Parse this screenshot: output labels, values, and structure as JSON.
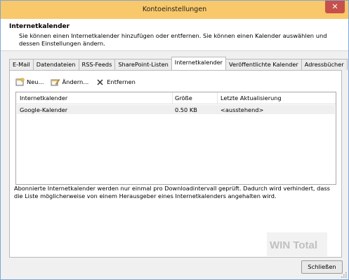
{
  "window": {
    "title": "Kontoeinstellungen",
    "close_glyph": "✕"
  },
  "header": {
    "title": "Internetkalender",
    "description": "Sie können einen Internetkalender hinzufügen oder entfernen. Sie können einen Kalender auswählen und dessen Einstellungen ändern."
  },
  "tabs": [
    {
      "label": "E-Mail"
    },
    {
      "label": "Datendateien"
    },
    {
      "label": "RSS-Feeds"
    },
    {
      "label": "SharePoint-Listen"
    },
    {
      "label": "Internetkalender",
      "active": true
    },
    {
      "label": "Veröffentlichte Kalender"
    },
    {
      "label": "Adressbücher"
    }
  ],
  "toolbar": {
    "new_label": "Neu...",
    "change_label": "Ändern...",
    "remove_label": "Entfernen"
  },
  "table": {
    "columns": [
      "Internetkalender",
      "Größe",
      "Letzte Aktualisierung"
    ],
    "rows": [
      [
        "Google-Kalender",
        "0.50 KB",
        "<ausstehend>"
      ]
    ]
  },
  "info_text": "Abonnierte Internetkalender werden nur einmal pro Downloadintervall geprüft. Dadurch wird verhindert, dass die Liste möglicherweise von einem Herausgeber eines Internetkalenders angehalten wird.",
  "watermark_text": "WIN Total",
  "close_button_label": "Schließen",
  "colors": {
    "titlebar": "#f8c86a",
    "close": "#c7504a",
    "frame": "#7aa7d8"
  }
}
